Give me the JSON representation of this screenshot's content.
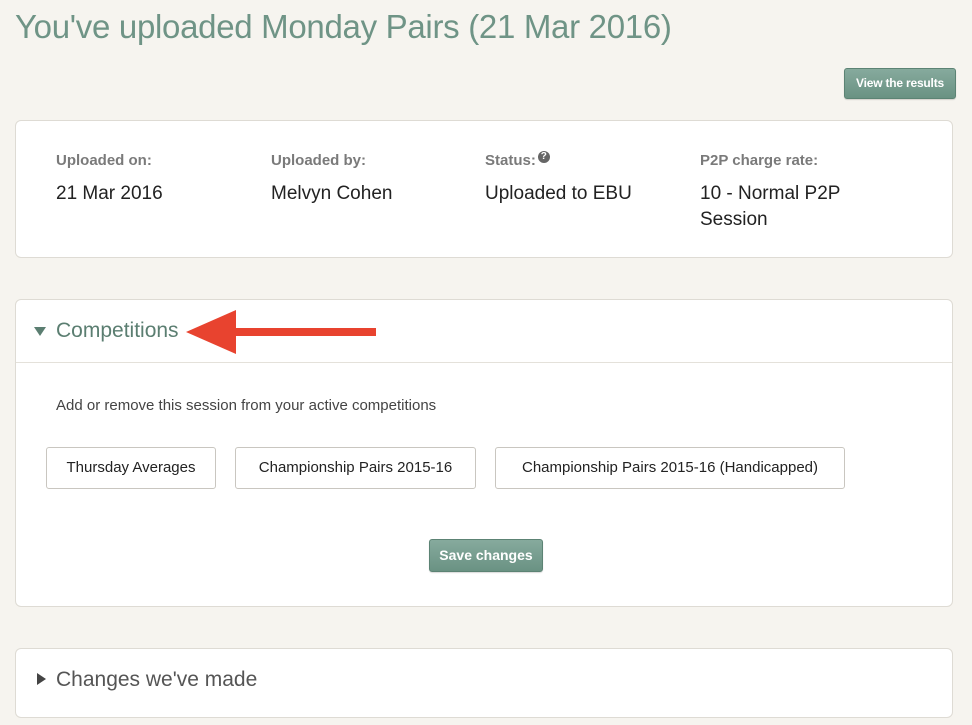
{
  "page": {
    "title": "You've uploaded Monday Pairs (21 Mar 2016)"
  },
  "actions": {
    "view_results_label": "View the results"
  },
  "info": {
    "uploaded_on": {
      "label": "Uploaded on:",
      "value": "21 Mar 2016"
    },
    "uploaded_by": {
      "label": "Uploaded by:",
      "value": "Melvyn Cohen"
    },
    "status": {
      "label": "Status:",
      "value": "Uploaded to EBU",
      "help_icon": "?"
    },
    "charge_rate": {
      "label": "P2P charge rate:",
      "value_line1": "10 - Normal P2P",
      "value_line2": "Session"
    }
  },
  "competitions": {
    "title": "Competitions",
    "expanded": true,
    "description": "Add or remove this session from your active competitions",
    "items": [
      {
        "label": "Thursday Averages"
      },
      {
        "label": "Championship Pairs 2015-16"
      },
      {
        "label": "Championship Pairs 2015-16 (Handicapped)"
      }
    ],
    "save_label": "Save changes"
  },
  "changes": {
    "title": "Changes we've made",
    "expanded": false
  },
  "colors": {
    "page_bg": "#f6f4ef",
    "accent_green": "#6f9486",
    "annotation_arrow": "#e8432f"
  },
  "icons": {
    "expanded": "caret-down-icon",
    "collapsed": "caret-right-icon",
    "status_help": "question-circle-icon",
    "annotation": "red-arrow-annotation"
  }
}
